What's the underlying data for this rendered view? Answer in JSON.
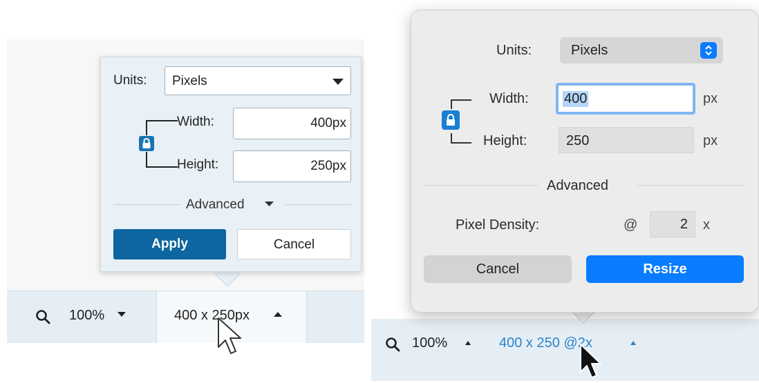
{
  "left": {
    "units_label": "Units:",
    "units_value": "Pixels",
    "width_label": "Width:",
    "width_value": "400px",
    "height_label": "Height:",
    "height_value": "250px",
    "advanced_label": "Advanced",
    "apply_label": "Apply",
    "cancel_label": "Cancel",
    "zoom_value": "100%",
    "dimensions_label": "400 x 250px"
  },
  "right": {
    "units_label": "Units:",
    "units_value": "Pixels",
    "width_label": "Width:",
    "width_value": "400",
    "width_unit": "px",
    "height_label": "Height:",
    "height_value": "250",
    "height_unit": "px",
    "advanced_label": "Advanced",
    "pixel_density_label": "Pixel Density:",
    "pixel_density_at": "@",
    "pixel_density_value": "2",
    "pixel_density_unit": "x",
    "cancel_label": "Cancel",
    "resize_label": "Resize",
    "zoom_value": "100%",
    "dimensions_label": "400 x 250 @2x"
  },
  "colors": {
    "left_accent": "#0d66a0",
    "right_accent": "#0a7cff",
    "link_blue": "#2b84c9"
  },
  "icons": [
    "search-icon",
    "lock-icon",
    "chevron-down-icon",
    "chevron-up-icon",
    "mouse-cursor-icon"
  ]
}
